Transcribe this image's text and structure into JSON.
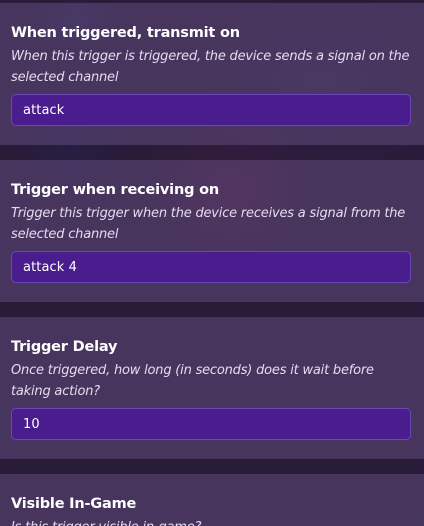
{
  "sections": [
    {
      "title": "When triggered, transmit on",
      "description": "When this trigger is triggered, the device sends a signal on the selected channel",
      "value": "attack"
    },
    {
      "title": "Trigger when receiving on",
      "description": "Trigger this trigger when the device receives a signal from the selected channel",
      "value": "attack 4"
    },
    {
      "title": "Trigger Delay",
      "description": "Once triggered, how long (in seconds) does it wait before taking action?",
      "value": "10"
    },
    {
      "title": "Visible In-Game",
      "description": "Is this trigger visible in-game?"
    }
  ]
}
